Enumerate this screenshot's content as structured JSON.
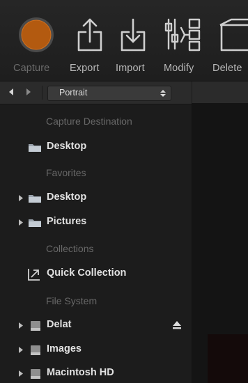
{
  "toolbar": {
    "tools": [
      {
        "label": "Capture",
        "icon": "capture-icon",
        "state": "disabled"
      },
      {
        "label": "Export",
        "icon": "export-icon",
        "state": "enabled"
      },
      {
        "label": "Import",
        "icon": "import-icon",
        "state": "enabled"
      },
      {
        "label": "Modify",
        "icon": "modify-icon",
        "state": "enabled"
      },
      {
        "label": "Delete",
        "icon": "delete-icon",
        "state": "enabled"
      }
    ]
  },
  "navbar": {
    "back_icon": "chevron-left-icon",
    "forward_icon": "chevron-right-icon",
    "workspace_select": {
      "value": "Portrait"
    }
  },
  "sidebar": {
    "sections": {
      "capture_destination": "Capture Destination",
      "favorites": "Favorites",
      "collections": "Collections",
      "file_system": "File System"
    },
    "capture_destination": {
      "label": "Desktop",
      "icon": "folder-icon"
    },
    "favorites": [
      {
        "label": "Desktop",
        "icon": "folder-icon"
      },
      {
        "label": "Pictures",
        "icon": "folder-icon"
      }
    ],
    "collections": [
      {
        "label": "Quick Collection",
        "icon": "quick-collection-icon"
      }
    ],
    "file_system": [
      {
        "label": "Delat",
        "icon": "drive-icon",
        "ejectable": true
      },
      {
        "label": "Images",
        "icon": "drive-icon",
        "ejectable": false
      },
      {
        "label": "Macintosh HD",
        "icon": "drive-icon",
        "ejectable": false
      }
    ]
  },
  "colors": {
    "capture_button": "#b35a10",
    "text_primary": "#e2e2e2",
    "text_section": "#686868",
    "background": "#1c1c1c"
  }
}
